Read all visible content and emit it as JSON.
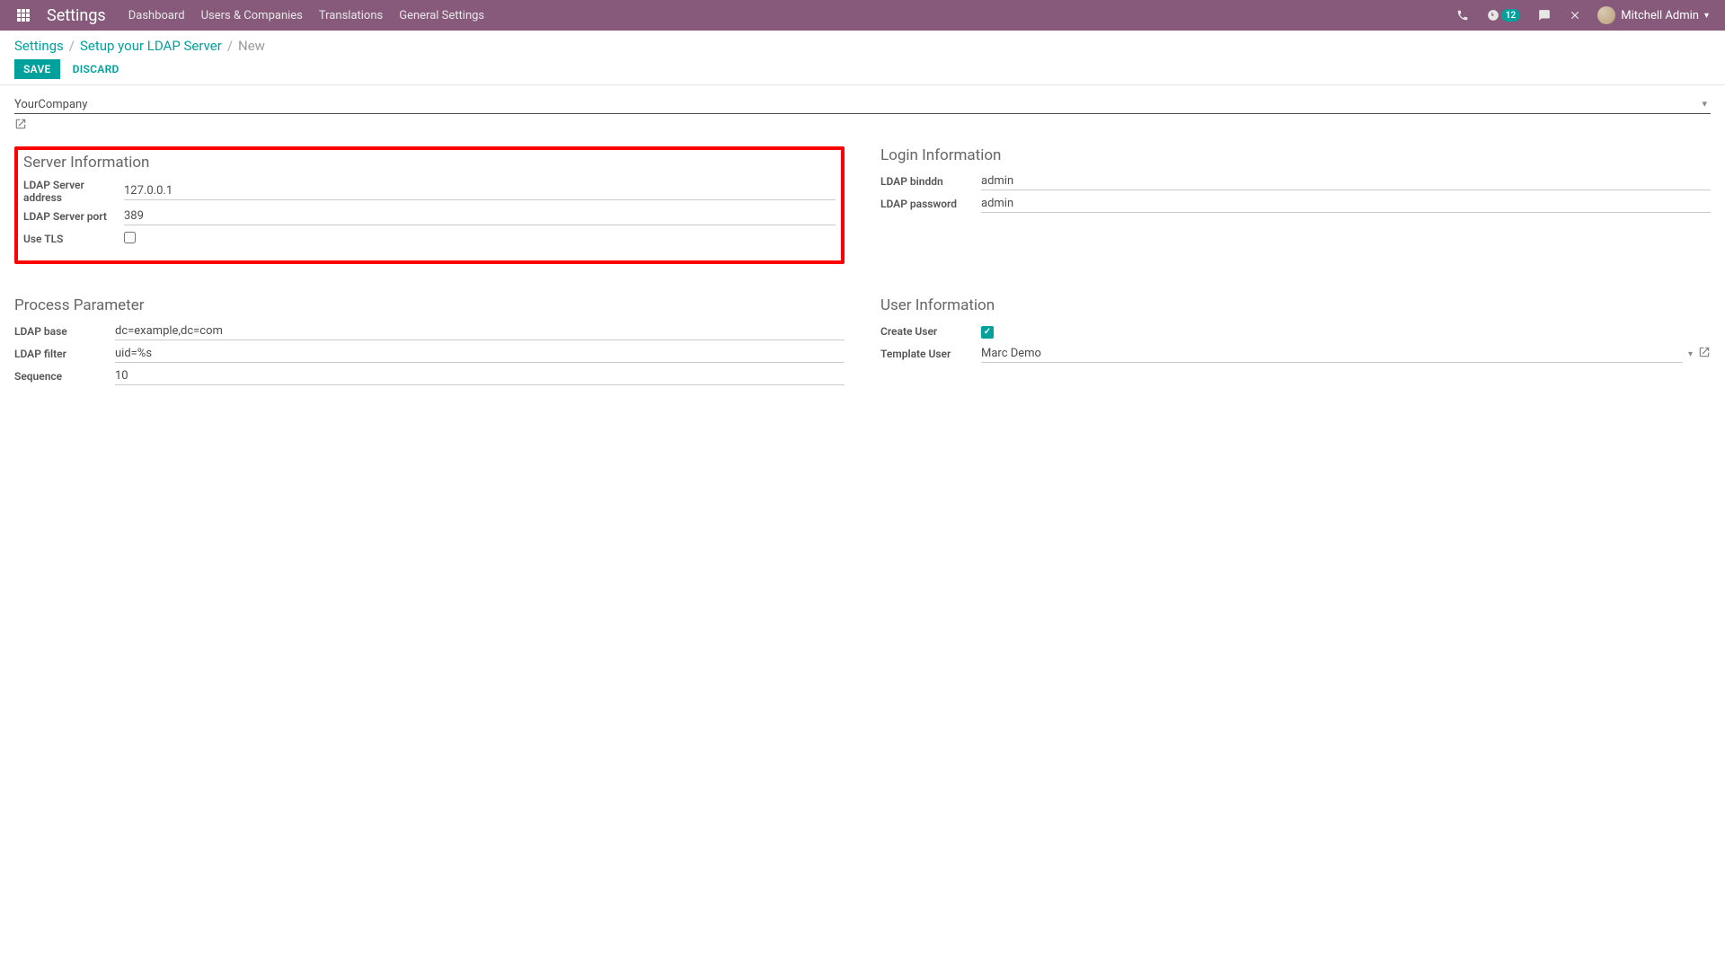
{
  "navbar": {
    "app_title": "Settings",
    "links": {
      "dashboard": "Dashboard",
      "users_companies": "Users & Companies",
      "translations": "Translations",
      "general_settings": "General Settings"
    },
    "activity_count": "12",
    "user_name": "Mitchell Admin"
  },
  "breadcrumb": {
    "settings": "Settings",
    "ldap": "Setup your LDAP Server",
    "current": "New"
  },
  "buttons": {
    "save": "Save",
    "discard": "Discard"
  },
  "company": {
    "value": "YourCompany"
  },
  "server_info": {
    "title": "Server Information",
    "address_label": "LDAP Server address",
    "address_value": "127.0.0.1",
    "port_label": "LDAP Server port",
    "port_value": "389",
    "tls_label": "Use TLS"
  },
  "login_info": {
    "title": "Login Information",
    "binddn_label": "LDAP binddn",
    "binddn_value": "admin",
    "password_label": "LDAP password",
    "password_value": "admin"
  },
  "process": {
    "title": "Process Parameter",
    "base_label": "LDAP base",
    "base_value": "dc=example,dc=com",
    "filter_label": "LDAP filter",
    "filter_value": "uid=%s",
    "sequence_label": "Sequence",
    "sequence_value": "10"
  },
  "user_info": {
    "title": "User Information",
    "create_user_label": "Create User",
    "template_user_label": "Template User",
    "template_user_value": "Marc Demo"
  }
}
